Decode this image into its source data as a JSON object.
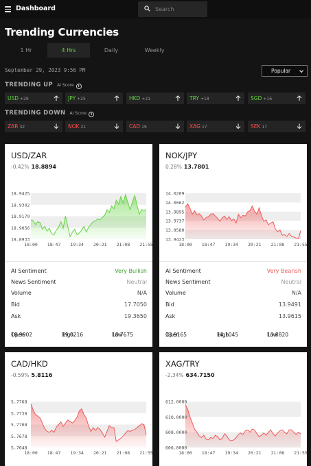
{
  "header": {
    "brand": "Dashboard",
    "search_placeholder": "Search"
  },
  "page_title": "Trending Currencies",
  "tabs": [
    {
      "label": "1 Hr",
      "active": false
    },
    {
      "label": "4 Hrs",
      "active": true
    },
    {
      "label": "Daily",
      "active": false
    },
    {
      "label": "Weekly",
      "active": false
    }
  ],
  "timestamp": "September 29, 2023 9:56 PM",
  "sort": {
    "selected": "Popular"
  },
  "trending_up": {
    "label": "TRENDING UP",
    "ai_label": "AI Score",
    "items": [
      {
        "code": "USD",
        "score": "+29"
      },
      {
        "code": "JPY",
        "score": "+25"
      },
      {
        "code": "HKD",
        "score": "+21"
      },
      {
        "code": "TRY",
        "score": "+18"
      },
      {
        "code": "SGD",
        "score": "+16"
      }
    ]
  },
  "trending_down": {
    "label": "TRENDING DOWN",
    "ai_label": "AI Score",
    "items": [
      {
        "code": "ZAR",
        "score": "32"
      },
      {
        "code": "NOK",
        "score": "21"
      },
      {
        "code": "CAD",
        "score": "19"
      },
      {
        "code": "XAG",
        "score": "17"
      },
      {
        "code": "SEK",
        "score": "17"
      }
    ]
  },
  "colors": {
    "up": "#62d43f",
    "down": "#ff4f4f",
    "bullish": "#3f9f2f",
    "bearish": "#ef5a5a"
  },
  "cards": [
    {
      "pair": "USD/ZAR",
      "change": "-0.42%",
      "price": "18.8894",
      "rows": [
        {
          "label": "AI Sentiment",
          "value": "Very Bullish"
        },
        {
          "label": "News Sentiment",
          "value": "Neutral"
        },
        {
          "label": "Volume",
          "value": "N/A"
        },
        {
          "label": "Bid",
          "value": "17.7050"
        },
        {
          "label": "Ask",
          "value": "19.3650"
        }
      ],
      "open": "18.9902",
      "high": "19.0216",
      "low": "18.7675"
    },
    {
      "pair": "NOK/JPY",
      "change": "0.28%",
      "price": "13.7801",
      "rows": [
        {
          "label": "AI Sentiment",
          "value": "Very Bearish"
        },
        {
          "label": "News Sentiment",
          "value": "Neutral"
        },
        {
          "label": "Volume",
          "value": "N/A"
        },
        {
          "label": "Bid",
          "value": "13.9491"
        },
        {
          "label": "Ask",
          "value": "13.9615"
        }
      ],
      "open": "13.9165",
      "high": "14.1045",
      "low": "13.8820"
    },
    {
      "pair": "CAD/HKD",
      "change": "-0.59%",
      "price": "5.8116"
    },
    {
      "pair": "XAG/TRY",
      "change": "-2.34%",
      "price": "634.7150"
    }
  ],
  "labels": {
    "open": "Open",
    "high": "High",
    "low": "Low"
  },
  "chart_data": [
    {
      "type": "area",
      "title": "USD/ZAR",
      "color": "#62d43f",
      "x_ticks": [
        "18:00",
        "18:47",
        "19:34",
        "20:21",
        "21:08",
        "21:55"
      ],
      "y_ticks": [
        "18.9425",
        "18.9302",
        "18.9179",
        "18.9056",
        "18.8933"
      ],
      "ylim": [
        18.8933,
        18.9425
      ],
      "x": [
        0,
        0.1,
        0.2,
        0.3,
        0.4,
        0.5,
        0.6,
        0.7,
        0.8,
        0.9,
        1.0,
        1.1,
        1.2,
        1.3,
        1.4,
        1.5,
        1.6,
        1.7,
        1.8,
        1.9,
        2.0,
        2.1,
        2.2,
        2.3,
        2.4,
        2.5,
        2.6,
        2.7,
        2.8,
        2.9,
        3.0,
        3.1,
        3.2,
        3.3,
        3.4,
        3.5,
        3.6,
        3.7,
        3.8,
        3.9,
        4.0,
        4.1,
        4.2,
        4.3,
        4.4,
        4.5,
        4.6,
        4.7,
        4.8,
        4.9,
        5.0
      ],
      "values": [
        18.914,
        18.913,
        18.909,
        18.912,
        18.911,
        18.904,
        18.907,
        18.902,
        18.905,
        18.899,
        18.898,
        18.903,
        18.906,
        18.912,
        18.905,
        18.918,
        18.907,
        18.896,
        18.901,
        18.904,
        18.898,
        18.9,
        18.903,
        18.907,
        18.901,
        18.906,
        18.909,
        18.912,
        18.913,
        18.915,
        18.914,
        18.917,
        18.919,
        18.925,
        18.922,
        18.929,
        18.926,
        18.935,
        18.931,
        18.939,
        18.932,
        18.941,
        18.933,
        18.925,
        18.933,
        18.94,
        18.93,
        18.92,
        18.925,
        18.924,
        18.925
      ]
    },
    {
      "type": "area",
      "title": "NOK/JPY",
      "color": "#ef5a5a",
      "x_ticks": [
        "18:00",
        "18:47",
        "19:34",
        "20:21",
        "21:08",
        "21:55"
      ],
      "y_ticks": [
        "14.0209",
        "14.0062",
        "13.9895",
        "13.9737",
        "13.9580",
        "13.9423"
      ],
      "ylim": [
        13.9423,
        14.0209
      ],
      "x": [
        0,
        0.1,
        0.2,
        0.3,
        0.4,
        0.5,
        0.6,
        0.7,
        0.8,
        0.9,
        1.0,
        1.1,
        1.2,
        1.3,
        1.4,
        1.5,
        1.6,
        1.7,
        1.8,
        1.9,
        2.0,
        2.1,
        2.2,
        2.3,
        2.4,
        2.5,
        2.6,
        2.7,
        2.8,
        2.9,
        3.0,
        3.1,
        3.2,
        3.3,
        3.4,
        3.5,
        3.6,
        3.7,
        3.8,
        3.9,
        4.0,
        4.1,
        4.2,
        4.3,
        4.4,
        4.5,
        4.6,
        4.7,
        4.8,
        4.9,
        5.0
      ],
      "values": [
        13.997,
        14.003,
        13.995,
        13.985,
        13.991,
        13.984,
        13.986,
        13.982,
        13.975,
        13.979,
        13.981,
        13.985,
        13.986,
        13.982,
        13.978,
        13.973,
        13.979,
        13.982,
        13.976,
        13.981,
        13.974,
        13.977,
        13.97,
        13.985,
        13.979,
        13.983,
        13.982,
        13.989,
        13.991,
        13.999,
        13.99,
        13.985,
        13.996,
        13.982,
        13.973,
        13.975,
        13.967,
        13.97,
        13.972,
        13.96,
        13.955,
        13.958,
        13.949,
        13.95,
        13.947,
        13.952,
        13.947,
        13.946,
        13.944,
        13.943,
        13.957
      ]
    },
    {
      "type": "area",
      "title": "CAD/HKD",
      "color": "#ef5a5a",
      "x_ticks": [
        "18:00",
        "18:47",
        "19:34",
        "20:21",
        "21:08",
        "21:55"
      ],
      "y_ticks": [
        "5.7768",
        "5.7738",
        "5.7708",
        "5.7678",
        "5.7648"
      ],
      "ylim": [
        5.7648,
        5.7768
      ],
      "x": [
        0,
        0.1,
        0.2,
        0.3,
        0.4,
        0.5,
        0.6,
        0.7,
        0.8,
        0.9,
        1.0,
        1.1,
        1.2,
        1.3,
        1.4,
        1.5,
        1.6,
        1.7,
        1.8,
        1.9,
        2.0,
        2.1,
        2.2,
        2.3,
        2.4,
        2.5,
        2.6,
        2.7,
        2.8,
        2.9,
        3.0,
        3.1,
        3.2,
        3.3,
        3.4,
        3.5,
        3.6,
        3.7,
        3.8,
        3.9,
        4.0,
        4.1,
        4.2,
        4.3,
        4.4,
        4.5,
        4.6,
        4.7,
        4.8,
        4.9,
        5.0
      ],
      "values": [
        5.7762,
        5.7746,
        5.7734,
        5.773,
        5.7725,
        5.7711,
        5.7697,
        5.769,
        5.7688,
        5.7693,
        5.7688,
        5.7701,
        5.7708,
        5.7715,
        5.7703,
        5.7712,
        5.772,
        5.7716,
        5.7712,
        5.7718,
        5.7727,
        5.7744,
        5.7749,
        5.7734,
        5.7725,
        5.7704,
        5.769,
        5.77,
        5.7693,
        5.77,
        5.7695,
        5.7685,
        5.7675,
        5.769,
        5.7705,
        5.77,
        5.77,
        5.7664,
        5.7668,
        5.7672,
        5.7678,
        5.7686,
        5.7692,
        5.769,
        5.7693,
        5.7695,
        5.77,
        5.7705,
        5.771,
        5.7708,
        5.7682
      ]
    },
    {
      "type": "area",
      "title": "XAG/TRY",
      "color": "#ef5a5a",
      "x_ticks": [
        "18:00",
        "18:47",
        "19:34",
        "20:21",
        "21:08",
        "21:55"
      ],
      "y_ticks": [
        "612.0000",
        "610.0000",
        "608.0000",
        "606.0000"
      ],
      "ylim": [
        606.0,
        612.0
      ],
      "x": [
        0,
        0.1,
        0.2,
        0.3,
        0.4,
        0.5,
        0.6,
        0.7,
        0.8,
        0.9,
        1.0,
        1.1,
        1.2,
        1.3,
        1.4,
        1.5,
        1.6,
        1.7,
        1.8,
        1.9,
        2.0,
        2.1,
        2.2,
        2.3,
        2.4,
        2.5,
        2.6,
        2.7,
        2.8,
        2.9,
        3.0,
        3.1,
        3.2,
        3.3,
        3.4,
        3.5,
        3.6,
        3.7,
        3.8,
        3.9,
        4.0,
        4.1,
        4.2,
        4.3,
        4.4,
        4.5,
        4.6,
        4.7,
        4.8,
        4.9,
        5.0
      ],
      "values": [
        611.6,
        611.0,
        610.0,
        609.2,
        608.4,
        608.0,
        607.5,
        607.3,
        607.6,
        607.1,
        607.0,
        607.3,
        607.2,
        607.6,
        607.4,
        607.0,
        607.2,
        607.8,
        607.5,
        607.0,
        606.9,
        607.0,
        607.3,
        607.7,
        607.9,
        607.7,
        608.2,
        608.3,
        608.0,
        608.4,
        608.3,
        607.8,
        607.4,
        607.6,
        607.9,
        607.6,
        608.0,
        608.3,
        607.8,
        607.5,
        607.9,
        608.2,
        608.3,
        608.0,
        607.8,
        608.3,
        608.3,
        608.0,
        607.7,
        608.0,
        607.8
      ]
    }
  ]
}
